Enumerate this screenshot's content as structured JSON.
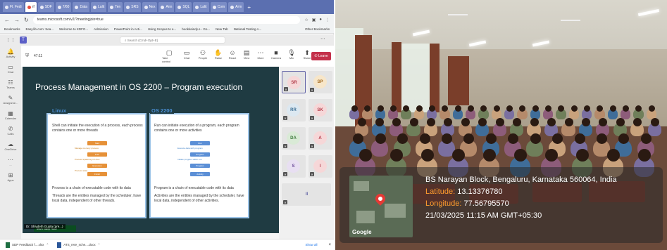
{
  "browser": {
    "tabs": [
      "Fl. Fedi",
      "rf",
      "SDF",
      "7/60",
      "Data",
      "Lalit",
      "Ten",
      "SRS",
      "Nex",
      "Ann",
      "SQL",
      "Lalit",
      "Com",
      "Arm"
    ],
    "url": "teams.microsoft.com/v2/?meetingjoin=true",
    "bookmarks": [
      "Bookmarks",
      "Easy.lib.com: Sea...",
      "Welcome to KDFG...",
      "Admission",
      "PowerPoint in Acti...",
      "Using Scopus to e...",
      "bookkaindy.o - Go...",
      "New Tab",
      "National Testing A...",
      "Other Bookmarks"
    ]
  },
  "teams": {
    "search_placeholder": "Search (Cmd+Opt+E)",
    "rail": [
      {
        "icon": "bell-icon",
        "label": "Activity"
      },
      {
        "icon": "chat-icon",
        "label": "Chat"
      },
      {
        "icon": "teams-icon",
        "label": "Teams"
      },
      {
        "icon": "assign-icon",
        "label": "Assignme..."
      },
      {
        "icon": "calendar-icon",
        "label": "Calendar"
      },
      {
        "icon": "phone-icon",
        "label": "Calls"
      },
      {
        "icon": "onedrive-icon",
        "label": "OneDrive"
      },
      {
        "icon": "more-icon",
        "label": "..."
      },
      {
        "icon": "apps-icon",
        "label": "Apps"
      }
    ],
    "meeting_timer": "47:11",
    "controls": [
      {
        "icon": "table-icon",
        "label": "Take control"
      },
      {
        "icon": "chat-icon",
        "label": "Chat"
      },
      {
        "icon": "people-icon",
        "label": "People"
      },
      {
        "icon": "raise-icon",
        "label": "Raise"
      },
      {
        "icon": "react-icon",
        "label": "React"
      },
      {
        "icon": "view-icon",
        "label": "View"
      },
      {
        "icon": "more-icon",
        "label": "More"
      },
      {
        "icon": "camera-icon",
        "label": "Camera"
      },
      {
        "icon": "mic-icon",
        "label": "Mic"
      },
      {
        "icon": "share-icon",
        "label": "Share"
      }
    ],
    "leave_label": "Leave",
    "presenter": "Dr. Shivdeth Gupta (pre...)"
  },
  "slide": {
    "title": "Process Management in OS 2200 – Program execution",
    "left_head": "Linux",
    "left_intro": "Shell can initiate the execution of a process, each process contains one or more threads",
    "left_flow": [
      "Start",
      "Fork",
      "Execution",
      "Finish"
    ],
    "left_flow_labels": [
      "Manage memory process",
      "Process spawning in Linux",
      "Process state"
    ],
    "left_bullets": [
      "Process is a chain of executable code with its data",
      "Threads are the entities managed by the scheduler, have local data, independent of other threads."
    ],
    "right_head": "OS 2200",
    "right_intro": "Run can initiate execution of a program, each program contains one or more activities",
    "right_flow": [
      "Run",
      "Program",
      "Program",
      "Activity"
    ],
    "right_flow_labels": [
      "Execute data with program",
      "Initiate program within run"
    ],
    "right_bullets": [
      "Program is a chain of executable code with its data",
      "Activities are the entities managed by the scheduler, have local data, independent of other activities."
    ],
    "footer": "Team  Navy Hour"
  },
  "gallery": [
    {
      "initials": "SR",
      "bg": "#f6d7d8",
      "fg": "#b23a48",
      "selected": true
    },
    {
      "initials": "SP",
      "bg": "#f7e6c9",
      "fg": "#a1661a",
      "selected": false
    },
    {
      "initials": "RR",
      "bg": "#dce8f1",
      "fg": "#3b6e93",
      "selected": false
    },
    {
      "initials": "SK",
      "bg": "#f6d7d8",
      "fg": "#b23a48",
      "selected": false
    },
    {
      "initials": "DA",
      "bg": "#d9ead6",
      "fg": "#3c7a3a",
      "selected": false
    },
    {
      "initials": "A",
      "bg": "#f6d7d8",
      "fg": "#b23a48",
      "selected": false
    },
    {
      "initials": "S",
      "bg": "#e8dff2",
      "fg": "#6b4a99",
      "selected": false
    },
    {
      "initials": "I",
      "bg": "#f6d7d8",
      "fg": "#b23a48",
      "selected": false
    },
    {
      "initials": "II",
      "bg": "#e4e4e4",
      "fg": "#6264a7",
      "selected": false
    }
  ],
  "downloads": {
    "items": [
      "SDP Feedback f....xlsx",
      "ATS_rere_sche....docx"
    ],
    "show_all": "Show all"
  },
  "geotag": {
    "address": "BS Narayan Block, Bengaluru, Karnataka 560064, India",
    "lat_label": "Latitude:",
    "lat": "13.13376780",
    "lon_label": "Longitude:",
    "lon": "77.56795570",
    "datetime": "21/03/2025 11:15 AM GMT+05:30",
    "map_brand": "Google"
  }
}
